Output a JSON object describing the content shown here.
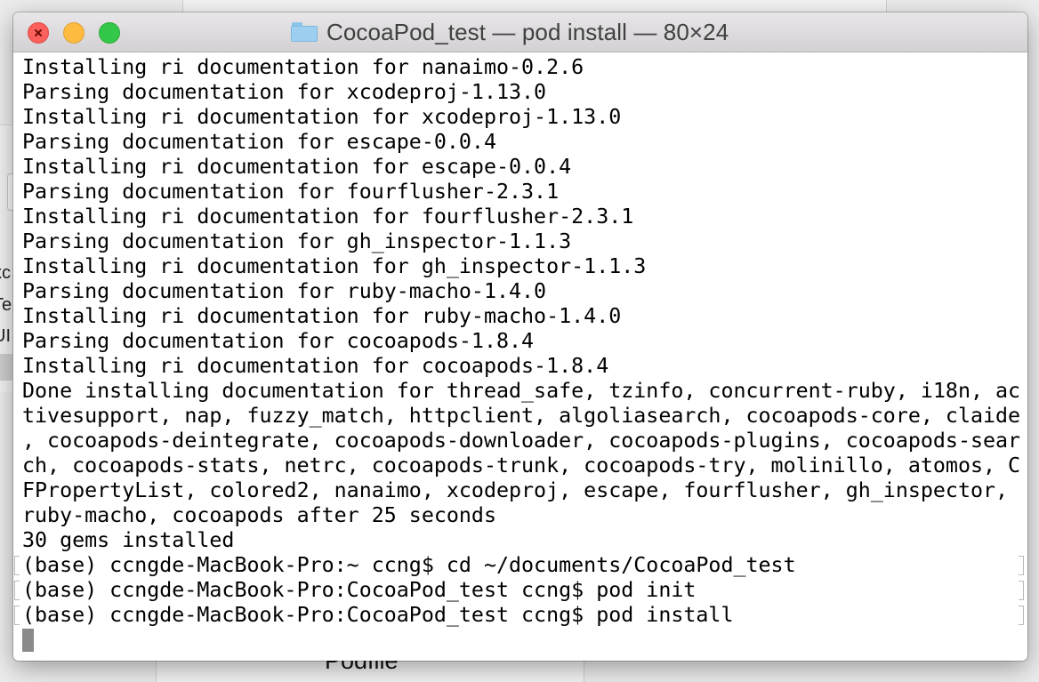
{
  "background": {
    "left_fragments": [
      "xc",
      "Te",
      "UI"
    ],
    "bottom_label": "Podfile"
  },
  "window": {
    "title": "CocoaPod_test — pod install — 80×24",
    "folder_icon": "folder-icon",
    "traffic_lights": {
      "close": "#fc605c",
      "minimize": "#fdbc40",
      "zoom": "#34c84a"
    }
  },
  "terminal": {
    "lines": [
      "Installing ri documentation for nanaimo-0.2.6",
      "Parsing documentation for xcodeproj-1.13.0",
      "Installing ri documentation for xcodeproj-1.13.0",
      "Parsing documentation for escape-0.0.4",
      "Installing ri documentation for escape-0.0.4",
      "Parsing documentation for fourflusher-2.3.1",
      "Installing ri documentation for fourflusher-2.3.1",
      "Parsing documentation for gh_inspector-1.1.3",
      "Installing ri documentation for gh_inspector-1.1.3",
      "Parsing documentation for ruby-macho-1.4.0",
      "Installing ri documentation for ruby-macho-1.4.0",
      "Parsing documentation for cocoapods-1.8.4",
      "Installing ri documentation for cocoapods-1.8.4",
      "Done installing documentation for thread_safe, tzinfo, concurrent-ruby, i18n, ac",
      "tivesupport, nap, fuzzy_match, httpclient, algoliasearch, cocoapods-core, claide",
      ", cocoapods-deintegrate, cocoapods-downloader, cocoapods-plugins, cocoapods-sear",
      "ch, cocoapods-stats, netrc, cocoapods-trunk, cocoapods-try, molinillo, atomos, C",
      "FPropertyList, colored2, nanaimo, xcodeproj, escape, fourflusher, gh_inspector,",
      "ruby-macho, cocoapods after 25 seconds",
      "30 gems installed"
    ],
    "prompts": [
      "(base) ccngde-MacBook-Pro:~ ccng$ cd ~/documents/CocoaPod_test",
      "(base) ccngde-MacBook-Pro:CocoaPod_test ccng$ pod init",
      "(base) ccngde-MacBook-Pro:CocoaPod_test ccng$ pod install"
    ],
    "cursor_color": "#8a8a8a"
  }
}
